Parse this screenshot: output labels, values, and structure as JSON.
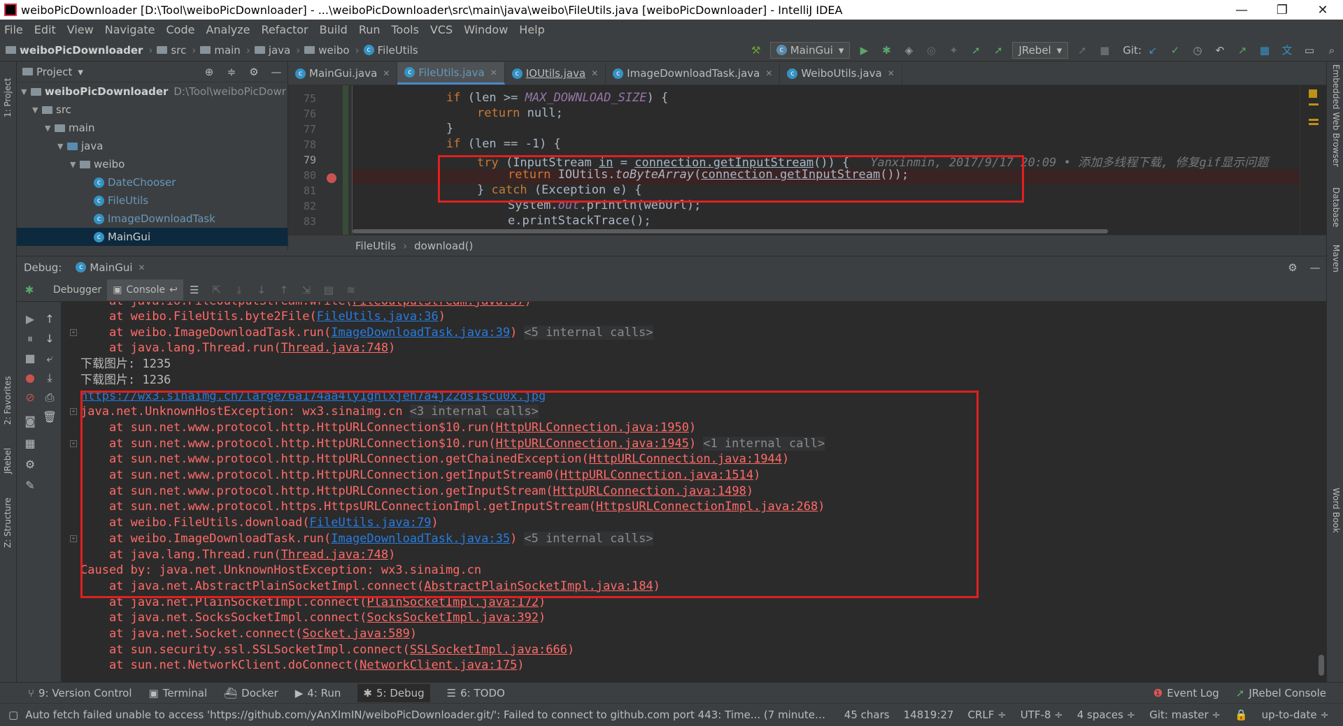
{
  "window": {
    "title": "weiboPicDownloader [D:\\Tool\\weiboPicDownloader] - ...\\weiboPicDownloader\\src\\main\\java\\weibo\\FileUtils.java [weiboPicDownloader] - IntelliJ IDEA",
    "minimize": "—",
    "maximize": "❐",
    "close": "✕"
  },
  "menu": [
    "File",
    "Edit",
    "View",
    "Navigate",
    "Code",
    "Analyze",
    "Refactor",
    "Build",
    "Run",
    "Tools",
    "VCS",
    "Window",
    "Help"
  ],
  "breadcrumbs": {
    "project": "weiboPicDownloader",
    "items": [
      "src",
      "main",
      "java",
      "weibo"
    ],
    "file": "FileUtils"
  },
  "toolbar": {
    "run_config": "MainGui",
    "jrebel": "JRebel",
    "git_label": "Git:"
  },
  "project_panel": {
    "title": "Project",
    "tree": [
      {
        "label": "weiboPicDownloader",
        "path": "D:\\Tool\\weiboPicDowr",
        "depth": 0,
        "type": "project"
      },
      {
        "label": "src",
        "depth": 1,
        "type": "folder"
      },
      {
        "label": "main",
        "depth": 2,
        "type": "folder"
      },
      {
        "label": "java",
        "depth": 3,
        "type": "folder"
      },
      {
        "label": "weibo",
        "depth": 4,
        "type": "package"
      },
      {
        "label": "DateChooser",
        "depth": 5,
        "type": "class"
      },
      {
        "label": "FileUtils",
        "depth": 5,
        "type": "class"
      },
      {
        "label": "ImageDownloadTask",
        "depth": 5,
        "type": "class"
      },
      {
        "label": "MainGui",
        "depth": 5,
        "type": "class",
        "selected": true
      }
    ]
  },
  "editor_tabs": [
    {
      "label": "MainGui.java",
      "active": false
    },
    {
      "label": "FileUtils.java",
      "active": true
    },
    {
      "label": "IOUtils.java",
      "active": false
    },
    {
      "label": "ImageDownloadTask.java",
      "active": false
    },
    {
      "label": "WeiboUtils.java",
      "active": false
    }
  ],
  "code": {
    "line_numbers": [
      "75",
      "76",
      "77",
      "78",
      "79",
      "80",
      "81",
      "82",
      "83"
    ],
    "line75_a": "if (len >= ",
    "line75_const": "MAX_DOWNLOAD_SIZE",
    "line75_b": ") {",
    "line76_kw": "return",
    "line76_b": " null;",
    "line77": "}",
    "line78_kw": "if",
    "line78_b": " (len == -1) {",
    "line79_kw": "try",
    "line79_a": " (InputStream ",
    "line79_in": "in",
    "line79_b": " = ",
    "line79_conn": "connection.getInputStream",
    "line79_c": "()) {",
    "line79_blame": "Yanxinmin, 2017/9/17 20:09 • 添加多线程下载, 修复gif显示问题",
    "line80_kw": "return",
    "line80_a": " IOUtils.",
    "line80_fn": "toByteArray",
    "line80_b": "(",
    "line80_conn": "connection.getInputStream",
    "line80_c": "());",
    "line81_a": "} ",
    "line81_kw": "catch",
    "line81_b": " (Exception e) {",
    "line82_a": "System.",
    "line82_out": "out",
    "line82_b": ".println(webUrl);",
    "line83": "e.printStackTrace();"
  },
  "code_breadcrumb": {
    "class": "FileUtils",
    "method": "download()"
  },
  "debug": {
    "label": "Debug:",
    "session": "MainGui",
    "debugger_tab": "Debugger",
    "console_tab": "Console"
  },
  "console": [
    {
      "prefix": "    at weibo.FileUtils.byte2File(",
      "link": "FileUtils.java:36",
      "suffix": ")",
      "style": "err",
      "linkstyle": "link"
    },
    {
      "prefix": "    at weibo.ImageDownloadTask.run(",
      "link": "ImageDownloadTask.java:39",
      "suffix": ")",
      "internal": "<5 internal calls>",
      "style": "err",
      "linkstyle": "link"
    },
    {
      "prefix": "    at java.lang.Thread.run(",
      "link": "Thread.java:748",
      "suffix": ")",
      "style": "err",
      "linkstyle": "link-gray"
    },
    {
      "prefix": "下载图片: 1235",
      "style": "out"
    },
    {
      "prefix": "下载图片: 1236",
      "style": "out"
    },
    {
      "prefix": "",
      "link": "https://wx3.sinaimg.cn/large/6a174aa4ly1gnlxjeh7a4j22ds1scu0x.jpg",
      "suffix": "",
      "style": "err",
      "linkstyle": "link"
    },
    {
      "prefix": "java.net.UnknownHostException: wx3.sinaimg.cn",
      "internal": "<3 internal calls>",
      "style": "err"
    },
    {
      "prefix": "    at sun.net.www.protocol.http.HttpURLConnection$10.run(",
      "link": "HttpURLConnection.java:1950",
      "suffix": ")",
      "style": "err",
      "linkstyle": "link-gray"
    },
    {
      "prefix": "    at sun.net.www.protocol.http.HttpURLConnection$10.run(",
      "link": "HttpURLConnection.java:1945",
      "suffix": ")",
      "internal": "<1 internal call>",
      "style": "err",
      "linkstyle": "link-gray"
    },
    {
      "prefix": "    at sun.net.www.protocol.http.HttpURLConnection.getChainedException(",
      "link": "HttpURLConnection.java:1944",
      "suffix": ")",
      "style": "err",
      "linkstyle": "link-gray"
    },
    {
      "prefix": "    at sun.net.www.protocol.http.HttpURLConnection.getInputStream0(",
      "link": "HttpURLConnection.java:1514",
      "suffix": ")",
      "style": "err",
      "linkstyle": "link-gray"
    },
    {
      "prefix": "    at sun.net.www.protocol.http.HttpURLConnection.getInputStream(",
      "link": "HttpURLConnection.java:1498",
      "suffix": ")",
      "style": "err",
      "linkstyle": "link-gray"
    },
    {
      "prefix": "    at sun.net.www.protocol.https.HttpsURLConnectionImpl.getInputStream(",
      "link": "HttpsURLConnectionImpl.java:268",
      "suffix": ")",
      "style": "err",
      "linkstyle": "link-gray"
    },
    {
      "prefix": "    at weibo.FileUtils.download(",
      "link": "FileUtils.java:79",
      "suffix": ")",
      "style": "err",
      "linkstyle": "link"
    },
    {
      "prefix": "    at weibo.ImageDownloadTask.run(",
      "link": "ImageDownloadTask.java:35",
      "suffix": ")",
      "internal": "<5 internal calls>",
      "style": "err",
      "linkstyle": "link"
    },
    {
      "prefix": "    at java.lang.Thread.run(",
      "link": "Thread.java:748",
      "suffix": ")",
      "style": "err",
      "linkstyle": "link-gray"
    },
    {
      "prefix": "Caused by: java.net.UnknownHostException: wx3.sinaimg.cn",
      "style": "err"
    },
    {
      "prefix": "    at java.net.AbstractPlainSocketImpl.connect(",
      "link": "AbstractPlainSocketImpl.java:184",
      "suffix": ")",
      "style": "err",
      "linkstyle": "link-gray"
    },
    {
      "prefix": "    at java.net.PlainSocketImpl.connect(",
      "link": "PlainSocketImpl.java:172",
      "suffix": ")",
      "style": "err",
      "linkstyle": "link-gray"
    },
    {
      "prefix": "    at java.net.SocksSocketImpl.connect(",
      "link": "SocksSocketImpl.java:392",
      "suffix": ")",
      "style": "err",
      "linkstyle": "link-gray"
    },
    {
      "prefix": "    at java.net.Socket.connect(",
      "link": "Socket.java:589",
      "suffix": ")",
      "style": "err",
      "linkstyle": "link-gray"
    },
    {
      "prefix": "    at sun.security.ssl.SSLSocketImpl.connect(",
      "link": "SSLSocketImpl.java:666",
      "suffix": ")",
      "style": "err",
      "linkstyle": "link-gray"
    },
    {
      "prefix": "    at sun.net.NetworkClient.doConnect(",
      "link": "NetworkClient.java:175",
      "suffix": ")",
      "style": "err",
      "linkstyle": "link-gray"
    }
  ],
  "bottom_tools": [
    {
      "label": "9: Version Control",
      "active": false
    },
    {
      "label": "Terminal",
      "active": false
    },
    {
      "label": "Docker",
      "active": false
    },
    {
      "label": "4: Run",
      "active": false
    },
    {
      "label": "5: Debug",
      "active": true
    },
    {
      "label": "6: TODO",
      "active": false
    }
  ],
  "bottom_right": {
    "event_log": "Event Log",
    "jrebel_console": "JRebel Console"
  },
  "status": {
    "message": "Auto fetch failed unable to access 'https://github.com/yAnXImIN/weiboPicDownloader.git/': Failed to connect to github.com port 443: Time... (7 minutes ago)",
    "chars": "45 chars",
    "position": "14819:27",
    "line_sep": "CRLF ÷",
    "encoding": "UTF-8 ÷",
    "indent": "4 spaces ÷",
    "git": "Git: master ÷",
    "uptodate": "up-to-date ÷"
  },
  "side_tools": {
    "left": [
      "1: Project",
      "2: Favorites",
      "JRebel",
      "Z: Structure"
    ],
    "right": [
      "Embedded Web Browser",
      "Database",
      "Maven",
      "Word Book"
    ]
  },
  "colors": {
    "error_text": "#ff6b68",
    "link": "#287bde",
    "keyword": "#cc7832",
    "highlight_box": "#e02020",
    "selection": "#0d293e"
  }
}
